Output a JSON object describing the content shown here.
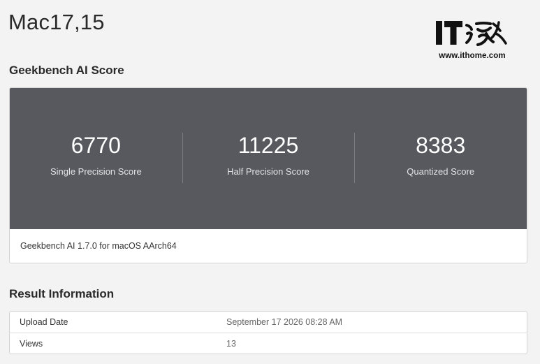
{
  "header": {
    "device_title": "Mac17,15"
  },
  "logo": {
    "mark_text": "IT之家",
    "url": "www.ithome.com"
  },
  "score_section": {
    "title": "Geekbench AI Score",
    "scores": [
      {
        "value": "6770",
        "label": "Single Precision Score"
      },
      {
        "value": "11225",
        "label": "Half Precision Score"
      },
      {
        "value": "8383",
        "label": "Quantized Score"
      }
    ],
    "footer": "Geekbench AI 1.7.0 for macOS AArch64"
  },
  "result_section": {
    "title": "Result Information",
    "rows": [
      {
        "key": "Upload Date",
        "value": "September 17 2026 08:28 AM"
      },
      {
        "key": "Views",
        "value": "13"
      }
    ]
  },
  "colors": {
    "page_bg": "#f3f3f3",
    "score_panel_bg": "#58595e",
    "card_bg": "#ffffff"
  }
}
